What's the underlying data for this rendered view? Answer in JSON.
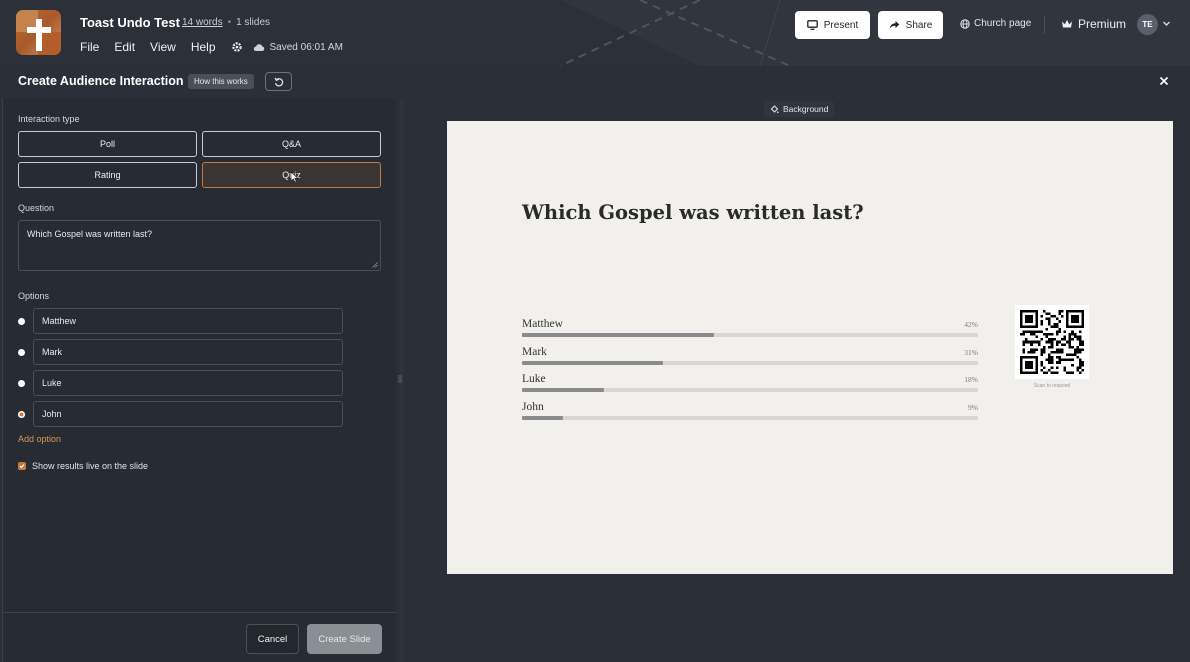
{
  "header": {
    "doc_title": "Toast Undo Test",
    "word_count": "14 words",
    "separator": "•",
    "slide_count": "1 slides",
    "menu": [
      "File",
      "Edit",
      "View",
      "Help"
    ],
    "saved_status": "Saved 06:01 AM",
    "present_label": "Present",
    "share_label": "Share",
    "church_page_label": "Church page",
    "premium_label": "Premium",
    "avatar_initials": "TE",
    "accent_color": "#c47a3c"
  },
  "panel": {
    "title": "Create Audience Interaction",
    "how_this_works": "How this works",
    "interaction_type_label": "Interaction type",
    "types": [
      {
        "label": "Poll",
        "active": false
      },
      {
        "label": "Q&A",
        "active": false
      },
      {
        "label": "Rating",
        "active": false
      },
      {
        "label": "Quiz",
        "active": true
      }
    ],
    "question_label": "Question",
    "question_value": "Which Gospel was written last?",
    "options_label": "Options",
    "options": [
      {
        "label": "Matthew",
        "correct": false
      },
      {
        "label": "Mark",
        "correct": false
      },
      {
        "label": "Luke",
        "correct": false
      },
      {
        "label": "John",
        "correct": true
      }
    ],
    "add_option": "Add option",
    "show_results_label": "Show results live on the slide",
    "show_results_checked": true,
    "cancel_label": "Cancel",
    "create_label": "Create Slide"
  },
  "preview": {
    "background_label": "Background",
    "question": "Which Gospel was written last?",
    "results": [
      {
        "label": "Matthew",
        "percent": 42,
        "percent_text": "42%"
      },
      {
        "label": "Mark",
        "percent": 31,
        "percent_text": "31%"
      },
      {
        "label": "Luke",
        "percent": 18,
        "percent_text": "18%"
      },
      {
        "label": "John",
        "percent": 9,
        "percent_text": "9%"
      }
    ],
    "qr_caption": "Scan to respond"
  }
}
